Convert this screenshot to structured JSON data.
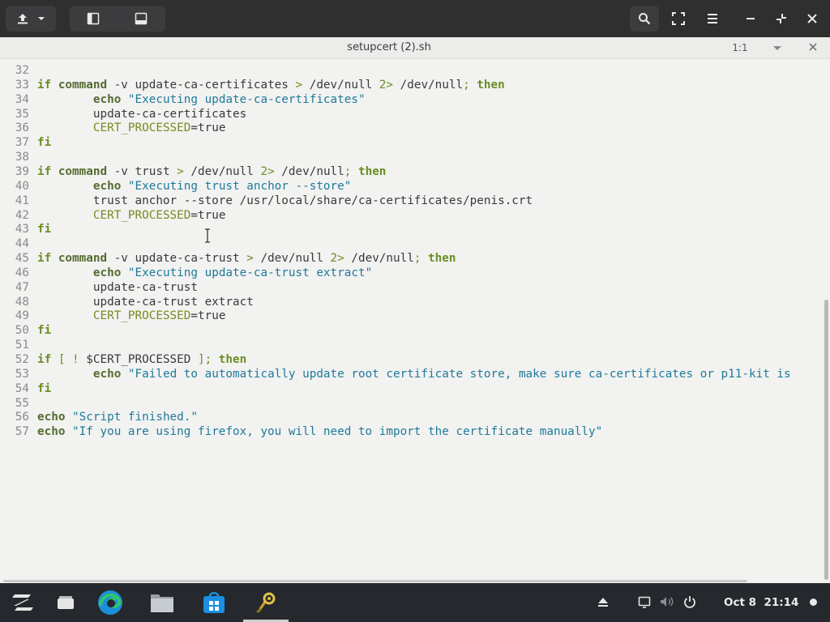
{
  "window": {
    "file_title": "setupcert (2).sh",
    "cursor_position": "1:1"
  },
  "header": {
    "left_icons": [
      "upload-icon",
      "chevron-down-icon",
      "sidebar-left-icon",
      "bottom-panel-icon"
    ],
    "right_icons": [
      "search-icon",
      "fullscreen-icon",
      "hamburger-menu-icon",
      "minimize-icon",
      "restore-icon",
      "close-icon"
    ]
  },
  "editor": {
    "lines": [
      {
        "n": "32",
        "tokens": []
      },
      {
        "n": "33",
        "tokens": [
          [
            "kw",
            "if "
          ],
          [
            "bi",
            "command"
          ],
          [
            "t",
            " -v update-ca-certificates "
          ],
          [
            "op",
            ">"
          ],
          [
            "t",
            " /dev/null "
          ],
          [
            "op",
            "2>"
          ],
          [
            "t",
            " /dev/null"
          ],
          [
            "op",
            ";"
          ],
          [
            "kw",
            " then"
          ]
        ]
      },
      {
        "n": "34",
        "tokens": [
          [
            "t",
            "        "
          ],
          [
            "bi",
            "echo"
          ],
          [
            "t",
            " "
          ],
          [
            "str",
            "\"Executing update-ca-certificates\""
          ]
        ]
      },
      {
        "n": "35",
        "tokens": [
          [
            "t",
            "        update-ca-certificates"
          ]
        ]
      },
      {
        "n": "36",
        "tokens": [
          [
            "t",
            "        "
          ],
          [
            "var",
            "CERT_PROCESSED"
          ],
          [
            "t",
            "=true"
          ]
        ]
      },
      {
        "n": "37",
        "tokens": [
          [
            "kw",
            "fi"
          ]
        ]
      },
      {
        "n": "38",
        "tokens": []
      },
      {
        "n": "39",
        "tokens": [
          [
            "kw",
            "if "
          ],
          [
            "bi",
            "command"
          ],
          [
            "t",
            " -v trust "
          ],
          [
            "op",
            ">"
          ],
          [
            "t",
            " /dev/null "
          ],
          [
            "op",
            "2>"
          ],
          [
            "t",
            " /dev/null"
          ],
          [
            "op",
            ";"
          ],
          [
            "kw",
            " then"
          ]
        ]
      },
      {
        "n": "40",
        "tokens": [
          [
            "t",
            "        "
          ],
          [
            "bi",
            "echo"
          ],
          [
            "t",
            " "
          ],
          [
            "str",
            "\"Executing trust anchor --store\""
          ]
        ]
      },
      {
        "n": "41",
        "tokens": [
          [
            "t",
            "        trust anchor --store /usr/local/share/ca-certificates/penis.crt"
          ]
        ]
      },
      {
        "n": "42",
        "tokens": [
          [
            "t",
            "        "
          ],
          [
            "var",
            "CERT_PROCESSED"
          ],
          [
            "t",
            "=true"
          ]
        ]
      },
      {
        "n": "43",
        "tokens": [
          [
            "kw",
            "fi"
          ]
        ]
      },
      {
        "n": "44",
        "tokens": []
      },
      {
        "n": "45",
        "tokens": [
          [
            "kw",
            "if "
          ],
          [
            "bi",
            "command"
          ],
          [
            "t",
            " -v update-ca-trust "
          ],
          [
            "op",
            ">"
          ],
          [
            "t",
            " /dev/null "
          ],
          [
            "op",
            "2>"
          ],
          [
            "t",
            " /dev/null"
          ],
          [
            "op",
            ";"
          ],
          [
            "kw",
            " then"
          ]
        ]
      },
      {
        "n": "46",
        "tokens": [
          [
            "t",
            "        "
          ],
          [
            "bi",
            "echo"
          ],
          [
            "t",
            " "
          ],
          [
            "str",
            "\"Executing update-ca-trust extract\""
          ]
        ]
      },
      {
        "n": "47",
        "tokens": [
          [
            "t",
            "        update-ca-trust"
          ]
        ]
      },
      {
        "n": "48",
        "tokens": [
          [
            "t",
            "        update-ca-trust extract"
          ]
        ]
      },
      {
        "n": "49",
        "tokens": [
          [
            "t",
            "        "
          ],
          [
            "var",
            "CERT_PROCESSED"
          ],
          [
            "t",
            "=true"
          ]
        ]
      },
      {
        "n": "50",
        "tokens": [
          [
            "kw",
            "fi"
          ]
        ]
      },
      {
        "n": "51",
        "tokens": []
      },
      {
        "n": "52",
        "tokens": [
          [
            "kw",
            "if"
          ],
          [
            "t",
            " "
          ],
          [
            "op",
            "["
          ],
          [
            "t",
            " "
          ],
          [
            "op",
            "!"
          ],
          [
            "t",
            " $CERT_PROCESSED "
          ],
          [
            "op",
            "]"
          ],
          [
            "op",
            ";"
          ],
          [
            "kw",
            " then"
          ]
        ]
      },
      {
        "n": "53",
        "tokens": [
          [
            "t",
            "        "
          ],
          [
            "bi",
            "echo"
          ],
          [
            "t",
            " "
          ],
          [
            "str",
            "\"Failed to automatically update root certificate store, make sure ca-certificates or p11-kit is"
          ]
        ]
      },
      {
        "n": "54",
        "tokens": [
          [
            "kw",
            "fi"
          ]
        ]
      },
      {
        "n": "55",
        "tokens": []
      },
      {
        "n": "56",
        "tokens": [
          [
            "bi",
            "echo"
          ],
          [
            "t",
            " "
          ],
          [
            "str",
            "\"Script finished.\""
          ]
        ]
      },
      {
        "n": "57",
        "tokens": [
          [
            "bi",
            "echo"
          ],
          [
            "t",
            " "
          ],
          [
            "str",
            "\"If you are using firefox, you will need to import the certificate manually\""
          ]
        ]
      }
    ]
  },
  "taskbar": {
    "apps": [
      {
        "name": "zorin-menu-icon"
      },
      {
        "name": "window-overview-icon"
      },
      {
        "name": "edge-browser-icon"
      },
      {
        "name": "files-icon"
      },
      {
        "name": "software-store-icon"
      },
      {
        "name": "gedit-editor-icon",
        "active": true
      }
    ],
    "tray_icons": [
      "eject-icon",
      "screen-icon",
      "volume-muted-icon",
      "power-icon"
    ],
    "clock_date": "Oct 8",
    "clock_time": "21:14"
  },
  "colors": {
    "headerbar": "#2f2f30",
    "editor_bg": "#f2f2f1",
    "keyword": "#6b8e23",
    "string": "#1e7a99",
    "taskbar": "#25282c"
  }
}
